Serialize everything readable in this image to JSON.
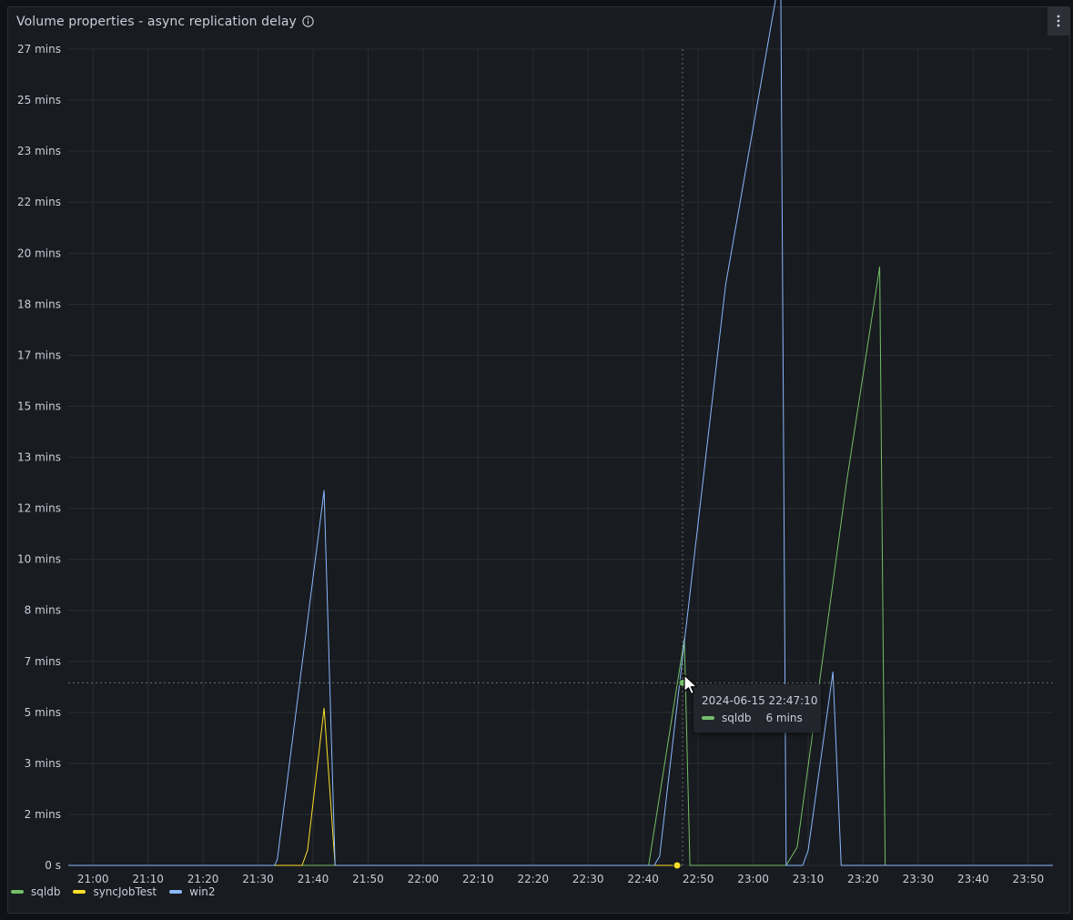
{
  "panel": {
    "title": "Volume properties - async replication delay",
    "info_icon": "info-circle-icon",
    "menu_icon": "kebab-menu-icon"
  },
  "chart_data": {
    "type": "line",
    "y_ticks": [
      "27 mins",
      "25 mins",
      "23 mins",
      "22 mins",
      "20 mins",
      "18 mins",
      "17 mins",
      "15 mins",
      "13 mins",
      "12 mins",
      "10 mins",
      "8 mins",
      "7 mins",
      "5 mins",
      "3 mins",
      "2 mins",
      "0 s"
    ],
    "x_ticks": [
      "21:00",
      "21:10",
      "21:20",
      "21:30",
      "21:40",
      "21:50",
      "22:00",
      "22:10",
      "22:20",
      "22:30",
      "22:40",
      "22:50",
      "23:00",
      "23:10",
      "23:20",
      "23:30",
      "23:40",
      "23:50"
    ],
    "x_unit": "minutes since 21:00",
    "ylim": [
      0,
      27
    ],
    "xlim": [
      -4.5,
      174.5
    ],
    "grid": true,
    "legend_placement": "bottom-left",
    "series": [
      {
        "name": "sqldb",
        "color": "#73bf69",
        "points": [
          [
            -4.5,
            0
          ],
          [
            101,
            0
          ],
          [
            107.5,
            7.5
          ],
          [
            108.5,
            0
          ],
          [
            126,
            0
          ],
          [
            128,
            0.6
          ],
          [
            137,
            12.7
          ],
          [
            143,
            19.8
          ],
          [
            144,
            0
          ],
          [
            174.5,
            0
          ]
        ]
      },
      {
        "name": "syncJobTest",
        "color": "#fade2a",
        "points": [
          [
            -4.5,
            0
          ],
          [
            38,
            0
          ],
          [
            39,
            0.5
          ],
          [
            42,
            5.2
          ],
          [
            44,
            0
          ],
          [
            107,
            0
          ]
        ]
      },
      {
        "name": "win2",
        "color": "#8ab8ff",
        "points": [
          [
            -4.5,
            0
          ],
          [
            33,
            0
          ],
          [
            33.5,
            0.2
          ],
          [
            42,
            12.4
          ],
          [
            44,
            0
          ],
          [
            102,
            0
          ],
          [
            103,
            0.3
          ],
          [
            115,
            19.2
          ],
          [
            125,
            29.6
          ],
          [
            126,
            0
          ],
          [
            129,
            0
          ],
          [
            130,
            0.5
          ],
          [
            134.5,
            6.4
          ],
          [
            136,
            0
          ],
          [
            174.5,
            0
          ]
        ]
      }
    ],
    "hover": {
      "time": "2024-06-15 22:47:10",
      "series": "sqldb",
      "value": "6 mins",
      "x": 107.17,
      "y": 6.04
    }
  }
}
